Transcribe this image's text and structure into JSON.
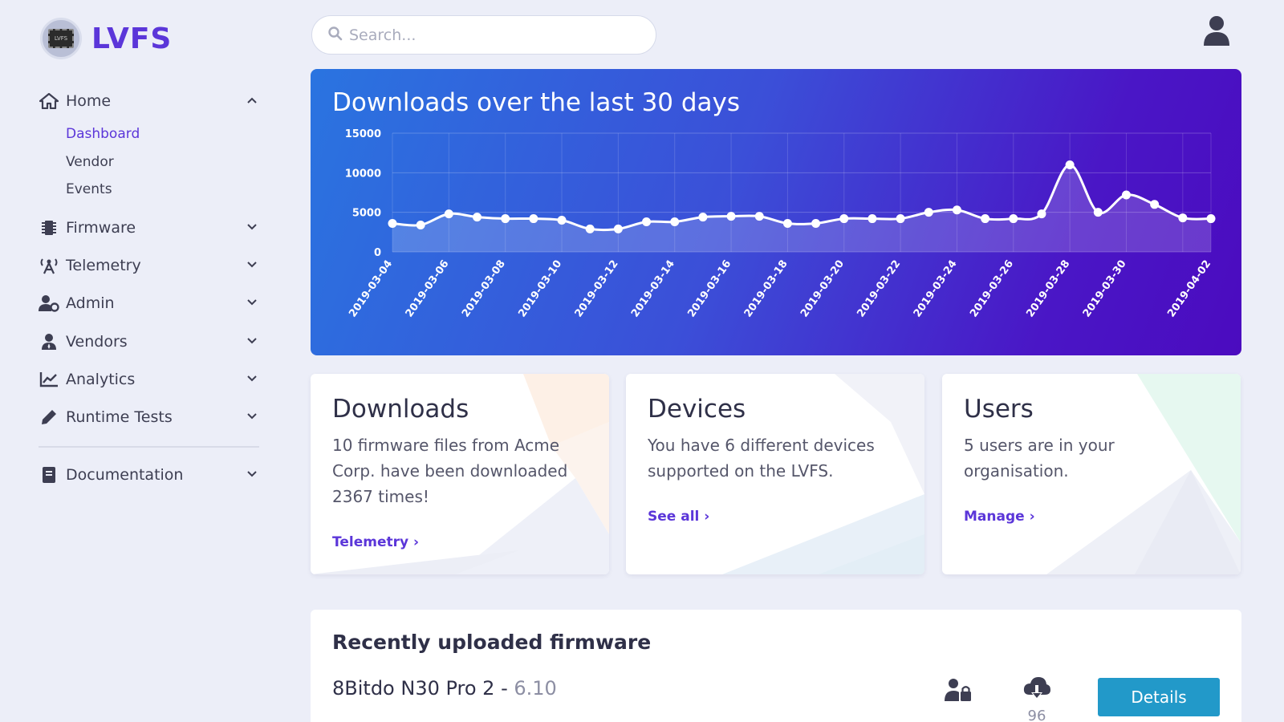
{
  "brand": {
    "name": "LVFS",
    "logo_text": "LVFS"
  },
  "search": {
    "placeholder": "Search..."
  },
  "sidebar": {
    "items": [
      {
        "label": "Home",
        "icon": "home-icon",
        "chevron": "up",
        "children": [
          "Dashboard",
          "Vendor",
          "Events"
        ],
        "active_child": "Dashboard"
      },
      {
        "label": "Firmware",
        "icon": "chip-icon",
        "chevron": "down"
      },
      {
        "label": "Telemetry",
        "icon": "antenna-icon",
        "chevron": "down"
      },
      {
        "label": "Admin",
        "icon": "user-gear-icon",
        "chevron": "down"
      },
      {
        "label": "Vendors",
        "icon": "user-tie-icon",
        "chevron": "down"
      },
      {
        "label": "Analytics",
        "icon": "line-chart-icon",
        "chevron": "down"
      },
      {
        "label": "Runtime Tests",
        "icon": "pen-icon",
        "chevron": "down"
      },
      {
        "label": "Documentation",
        "icon": "book-icon",
        "chevron": "down"
      }
    ]
  },
  "chart_data": {
    "type": "line",
    "title": "Downloads over the last 30 days",
    "xlabel": "",
    "ylabel": "",
    "ylim": [
      0,
      15000
    ],
    "y_ticks": [
      0,
      5000,
      10000,
      15000
    ],
    "grid": true,
    "x_tick_labels": [
      "2019-03-04",
      "2019-03-06",
      "2019-03-08",
      "2019-03-10",
      "2019-03-12",
      "2019-03-14",
      "2019-03-16",
      "2019-03-18",
      "2019-03-20",
      "2019-03-22",
      "2019-03-24",
      "2019-03-26",
      "2019-03-28",
      "2019-03-30",
      "2019-04-02"
    ],
    "x": [
      "2019-03-04",
      "2019-03-05",
      "2019-03-06",
      "2019-03-07",
      "2019-03-08",
      "2019-03-09",
      "2019-03-10",
      "2019-03-11",
      "2019-03-12",
      "2019-03-13",
      "2019-03-14",
      "2019-03-15",
      "2019-03-16",
      "2019-03-17",
      "2019-03-18",
      "2019-03-19",
      "2019-03-20",
      "2019-03-21",
      "2019-03-22",
      "2019-03-23",
      "2019-03-24",
      "2019-03-25",
      "2019-03-26",
      "2019-03-27",
      "2019-03-28",
      "2019-03-29",
      "2019-03-30",
      "2019-03-31",
      "2019-04-01",
      "2019-04-02"
    ],
    "values": [
      3600,
      3400,
      4800,
      4400,
      4200,
      4200,
      4000,
      2900,
      2900,
      3800,
      3800,
      4400,
      4500,
      4500,
      3600,
      3600,
      4200,
      4200,
      4200,
      5000,
      5300,
      4200,
      4200,
      4800,
      11000,
      5000,
      7200,
      6000,
      4300,
      4200
    ]
  },
  "cards": [
    {
      "title": "Downloads",
      "text": "10 firmware files from Acme Corp. have been downloaded 2367 times!",
      "link": "Telemetry ›"
    },
    {
      "title": "Devices",
      "text": "You have 6 different devices supported on the LVFS.",
      "link": "See all ›"
    },
    {
      "title": "Users",
      "text": "5 users are in your organisation.",
      "link": "Manage ›"
    }
  ],
  "recent": {
    "title": "Recently uploaded firmware",
    "item": {
      "name": "8Bitdo N30 Pro 2 - ",
      "version": "6.10",
      "downloads": "96",
      "button": "Details"
    }
  },
  "colors": {
    "accent": "#5b36d9",
    "details_button": "#2299c9",
    "chart_gradient_start": "#2a74e0",
    "chart_gradient_end": "#4b0bbf"
  }
}
